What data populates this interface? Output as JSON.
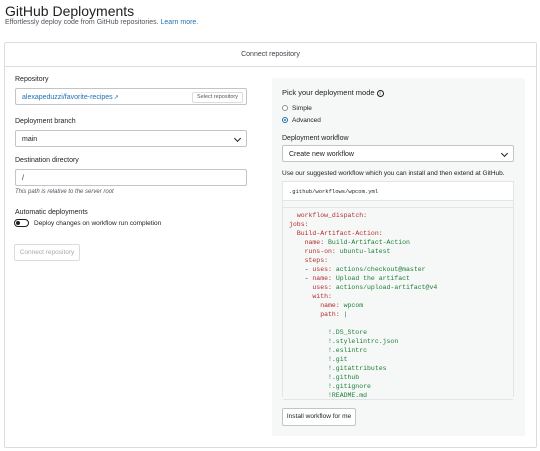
{
  "page": {
    "title": "GitHub Deployments",
    "subtitle": "Effortlessly deploy code from GitHub repositories.",
    "learn_more": "Learn more."
  },
  "card": {
    "header": "Connect repository"
  },
  "repository": {
    "label": "Repository",
    "value": "alexapeduzzi/favorite-recipes",
    "external_icon": "external-link-icon",
    "select_button": "Select repository"
  },
  "branch": {
    "label": "Deployment branch",
    "value": "main"
  },
  "destination": {
    "label": "Destination directory",
    "value": "/",
    "hint": "This path is relative to the server root"
  },
  "automatic": {
    "label": "Automatic deployments",
    "toggle_label": "Deploy changes on workflow run completion",
    "enabled": false
  },
  "connect_button": "Connect repository",
  "mode": {
    "title": "Pick your deployment mode",
    "info_icon": "info-icon",
    "options": [
      "Simple",
      "Advanced"
    ],
    "selected": "Advanced"
  },
  "workflow": {
    "label": "Deployment workflow",
    "value": "Create new workflow",
    "description": "Use our suggested workflow which you can install and then extend at GitHub.",
    "path": ".github/workflows/wpcom.yml",
    "code_lines": [
      "  workflow_dispatch:",
      "jobs:",
      "  Build-Artifact-Action:",
      "    name: Build-Artifact-Action",
      "    runs-on: ubuntu-latest",
      "    steps:",
      "    - uses: actions/checkout@master",
      "    - name: Upload the artifact",
      "      uses: actions/upload-artifact@v4",
      "      with:",
      "        name: wpcom",
      "        path: |",
      "",
      "          !.DS_Store",
      "          !.stylelintrc.json",
      "          !.eslintrc",
      "          !.git",
      "          !.gitattributes",
      "          !.github",
      "          !.gitignore",
      "          !README.md"
    ],
    "install_button": "Install workflow for me"
  },
  "colors": {
    "accent": "#2271b1",
    "code_key": "#b32d2e",
    "code_value": "#1a7f37"
  }
}
